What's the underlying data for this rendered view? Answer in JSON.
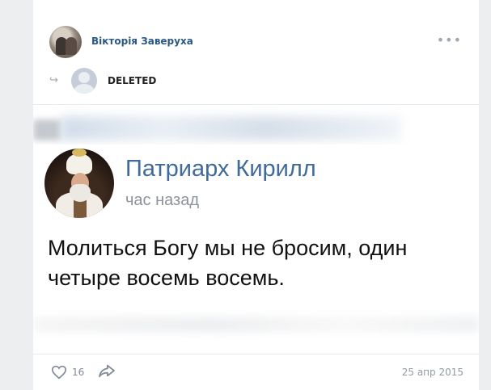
{
  "post": {
    "author": "Вікторія Заверуха",
    "repost_from": "DELETED",
    "likes": "16",
    "date": "25 апр 2015"
  },
  "image": {
    "name": "Патриарх Кирилл",
    "time": "час назад",
    "text": "Молиться Богу мы не бросим, один четыре восемь восемь."
  },
  "icons": {
    "menu": "more-dots-icon",
    "repost": "repost-arrow-icon",
    "like": "heart-icon",
    "share": "share-arrow-icon"
  },
  "colors": {
    "link": "#2a5885",
    "name_blue": "#3f6a9a",
    "muted": "#939aa3",
    "background": "#edeef0"
  }
}
